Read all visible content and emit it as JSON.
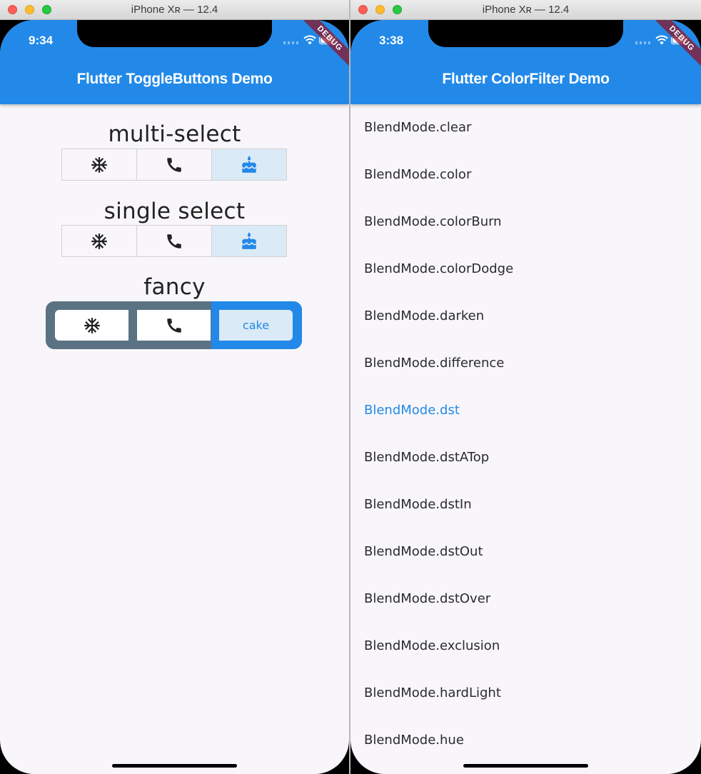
{
  "left_window": {
    "window_title": "iPhone Xʀ — 12.4",
    "status_time": "9:34",
    "debug_banner": "DEBUG",
    "app_title": "Flutter ToggleButtons Demo",
    "sections": [
      {
        "title": "multi-select",
        "buttons": [
          {
            "icon": "ac-unit-icon",
            "selected": false
          },
          {
            "icon": "call-icon",
            "selected": false
          },
          {
            "icon": "cake-icon",
            "selected": true
          }
        ]
      },
      {
        "title": "single select",
        "buttons": [
          {
            "icon": "ac-unit-icon",
            "selected": false
          },
          {
            "icon": "call-icon",
            "selected": false
          },
          {
            "icon": "cake-icon",
            "selected": true
          }
        ]
      },
      {
        "title": "fancy",
        "buttons": [
          {
            "icon": "ac-unit-icon",
            "selected": false
          },
          {
            "icon": "call-icon",
            "selected": false
          },
          {
            "label": "cake",
            "selected": true
          }
        ]
      }
    ],
    "colors": {
      "primary": "#2289e8",
      "selected_fill": "#dbeaf7",
      "fancy_border": "#5a7282"
    }
  },
  "right_window": {
    "window_title": "iPhone Xʀ — 12.4",
    "status_time": "3:38",
    "debug_banner": "DEBUG",
    "app_title": "Flutter ColorFilter Demo",
    "blend_modes": [
      "BlendMode.clear",
      "BlendMode.color",
      "BlendMode.colorBurn",
      "BlendMode.colorDodge",
      "BlendMode.darken",
      "BlendMode.difference",
      "BlendMode.dst",
      "BlendMode.dstATop",
      "BlendMode.dstIn",
      "BlendMode.dstOut",
      "BlendMode.dstOver",
      "BlendMode.exclusion",
      "BlendMode.hardLight",
      "BlendMode.hue"
    ],
    "selected_blend_mode": "BlendMode.dst"
  }
}
